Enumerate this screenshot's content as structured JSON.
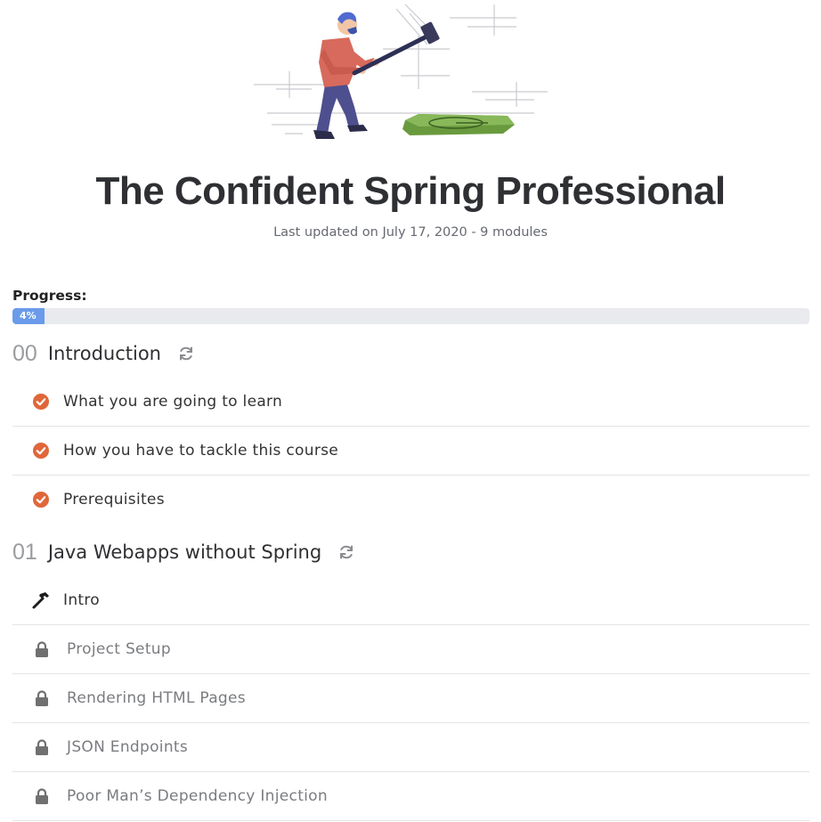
{
  "course": {
    "title": "The Confident Spring Professional",
    "meta": "Last updated on July 17, 2020 - 9 modules"
  },
  "progress": {
    "label": "Progress:",
    "percent_text": "4%",
    "fraction": 0.04,
    "fill_color": "#6a9bea"
  },
  "colors": {
    "done": "#e0673a",
    "locked": "#707070",
    "sync": "#8a8c90"
  },
  "modules": [
    {
      "number": "00",
      "title": "Introduction",
      "icon": "sync-icon",
      "lessons": [
        {
          "label": "What you are going to learn",
          "status": "done",
          "icon": "check-circle-icon"
        },
        {
          "label": "How you have to tackle this course",
          "status": "done",
          "icon": "check-circle-icon"
        },
        {
          "label": "Prerequisites",
          "status": "done",
          "icon": "check-circle-icon"
        }
      ]
    },
    {
      "number": "01",
      "title": "Java Webapps without Spring",
      "icon": "sync-icon",
      "lessons": [
        {
          "label": "Intro",
          "status": "current",
          "icon": "hammer-icon"
        },
        {
          "label": "Project Setup",
          "status": "locked",
          "icon": "lock-icon"
        },
        {
          "label": "Rendering HTML Pages",
          "status": "locked",
          "icon": "lock-icon"
        },
        {
          "label": "JSON Endpoints",
          "status": "locked",
          "icon": "lock-icon"
        },
        {
          "label": "Poor Man’s Dependency Injection",
          "status": "locked",
          "icon": "lock-icon"
        }
      ]
    }
  ]
}
